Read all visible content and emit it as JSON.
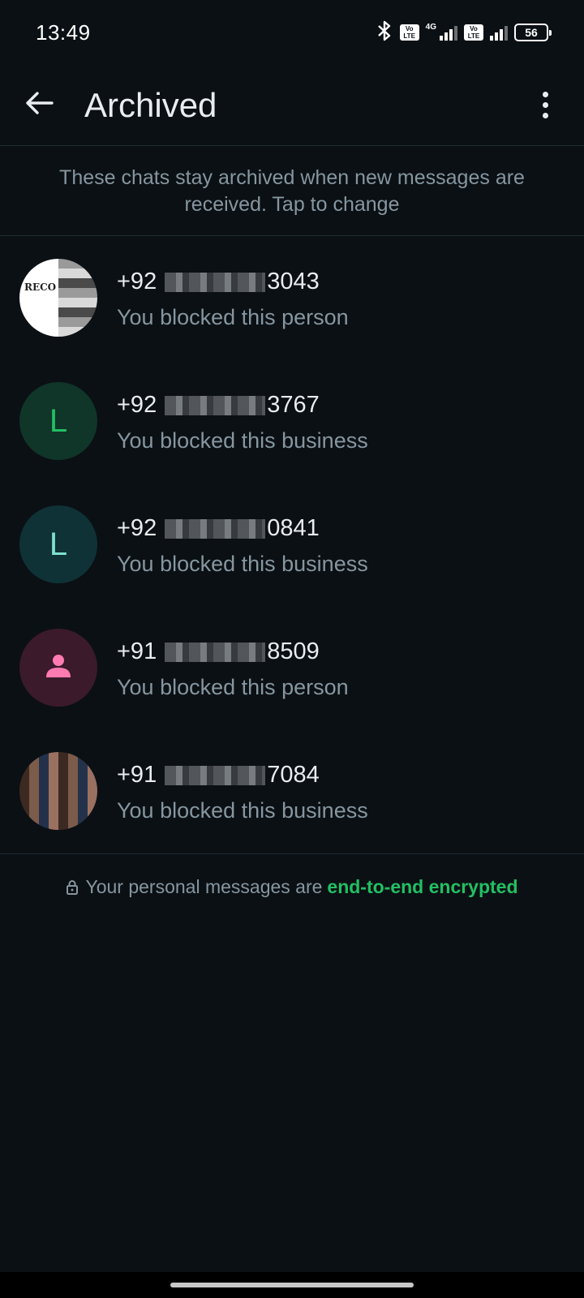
{
  "status_bar": {
    "time": "13:49",
    "network_type": "4G",
    "volte_label": "Vo LTE",
    "battery_level": "56"
  },
  "app_bar": {
    "title": "Archived",
    "back_icon": "arrow-left-icon",
    "menu_icon": "more-vert-icon"
  },
  "info_banner": {
    "text": "These chats stay archived when new messages are received. Tap to change"
  },
  "chats": [
    {
      "prefix": "+92",
      "suffix": "3043",
      "preview": "You blocked this person",
      "avatar_type": "photo"
    },
    {
      "prefix": "+92",
      "suffix": "3767",
      "preview": "You blocked this business",
      "avatar_type": "letter",
      "avatar_letter": "L",
      "avatar_bg": "#103529",
      "avatar_fg": "#21c063"
    },
    {
      "prefix": "+92",
      "suffix": "0841",
      "preview": "You blocked this business",
      "avatar_type": "letter",
      "avatar_letter": "L",
      "avatar_bg": "#0f3236",
      "avatar_fg": "#7fe0d0"
    },
    {
      "prefix": "+91",
      "suffix": "8509",
      "preview": "You blocked this person",
      "avatar_type": "person",
      "avatar_bg": "#3b1a2b",
      "avatar_fg": "#ff7bb1"
    },
    {
      "prefix": "+91",
      "suffix": "7084",
      "preview": "You blocked this business",
      "avatar_type": "photo"
    }
  ],
  "footer": {
    "text": "Your personal messages are",
    "link": "end-to-end encrypted",
    "link_color": "#21c063"
  }
}
